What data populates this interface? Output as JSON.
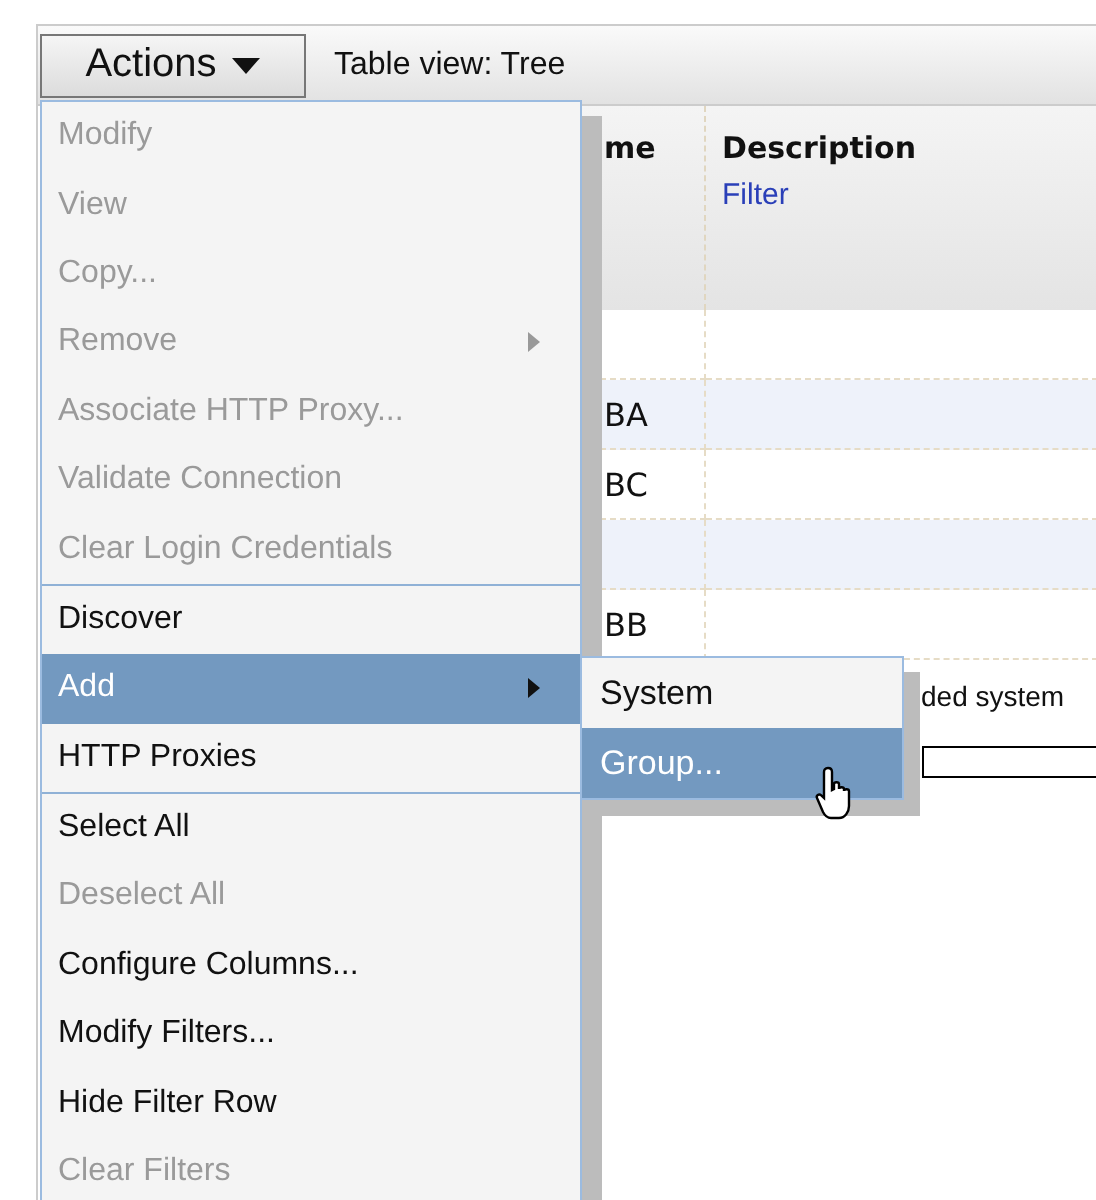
{
  "toolbar": {
    "actions_button": "Actions",
    "table_view": "Table view: Tree"
  },
  "table": {
    "columns": [
      {
        "label": "me"
      },
      {
        "label": "Description",
        "filter": "Filter"
      }
    ],
    "rows": [
      {
        "kind": "text"
      },
      {
        "kind": "text",
        "column_1": "BA"
      },
      {
        "kind": "text",
        "column_1": "BC"
      },
      {
        "kind": "text"
      },
      {
        "kind": "text",
        "column_1": "BB"
      },
      {
        "kind": "text",
        "description": "ded system"
      },
      {
        "kind": "field"
      }
    ]
  },
  "menu": {
    "groups": [
      [
        {
          "label": "Modify",
          "disabled": true,
          "selected": false,
          "has_submenu": false
        },
        {
          "label": "View",
          "disabled": true,
          "selected": false,
          "has_submenu": false
        },
        {
          "label": "Copy...",
          "disabled": true,
          "selected": false,
          "has_submenu": false
        },
        {
          "label": "Remove",
          "disabled": true,
          "selected": false,
          "has_submenu": true
        },
        {
          "label": "Associate HTTP Proxy...",
          "disabled": true,
          "selected": false,
          "has_submenu": false
        },
        {
          "label": "Validate Connection",
          "disabled": true,
          "selected": false,
          "has_submenu": false
        },
        {
          "label": "Clear Login Credentials",
          "disabled": true,
          "selected": false,
          "has_submenu": false
        }
      ],
      [
        {
          "label": "Discover",
          "disabled": false,
          "selected": false,
          "has_submenu": false
        },
        {
          "label": "Add",
          "disabled": false,
          "selected": true,
          "has_submenu": true
        },
        {
          "label": "HTTP Proxies",
          "disabled": false,
          "selected": false,
          "has_submenu": false
        }
      ],
      [
        {
          "label": "Select All",
          "disabled": false,
          "selected": false,
          "has_submenu": false
        },
        {
          "label": "Deselect All",
          "disabled": true,
          "selected": false,
          "has_submenu": false
        },
        {
          "label": "Configure Columns...",
          "disabled": false,
          "selected": false,
          "has_submenu": false
        },
        {
          "label": "Modify Filters...",
          "disabled": false,
          "selected": false,
          "has_submenu": false
        },
        {
          "label": "Hide Filter Row",
          "disabled": false,
          "selected": false,
          "has_submenu": false
        },
        {
          "label": "Clear Filters",
          "disabled": true,
          "selected": false,
          "has_submenu": false
        }
      ]
    ]
  },
  "submenu": {
    "items": [
      {
        "label": "System",
        "selected": false
      },
      {
        "label": "Group...",
        "selected": true
      }
    ]
  }
}
